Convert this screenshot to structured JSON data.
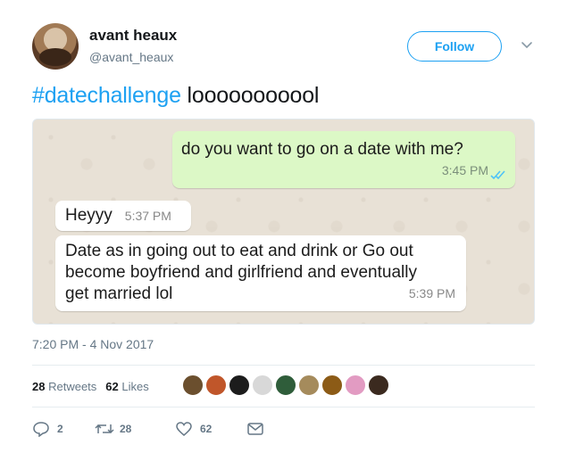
{
  "user": {
    "name": "avant heaux",
    "handle": "@avant_heaux",
    "follow_label": "Follow"
  },
  "tweet": {
    "hashtag": "#datechallenge",
    "text": " looooooooool",
    "timestamp": "7:20 PM - 4 Nov 2017"
  },
  "chat": {
    "outgoing": {
      "text": "do you want to go on a date with me?",
      "time": "3:45 PM"
    },
    "incoming1": {
      "text": "Heyyy",
      "time": "5:37 PM"
    },
    "incoming2": {
      "text": "Date as in going out to eat and drink or    Go out become boyfriend and girlfriend and eventually get married lol",
      "time": "5:39 PM"
    }
  },
  "stats": {
    "retweets_count": "28",
    "retweets_label": "Retweets",
    "likes_count": "62",
    "likes_label": "Likes"
  },
  "likers": [
    {
      "icon": "liker-avatar",
      "color": "#6b4f2e"
    },
    {
      "icon": "liker-avatar",
      "color": "#c0562a"
    },
    {
      "icon": "liker-avatar",
      "color": "#1c1c1c"
    },
    {
      "icon": "liker-avatar",
      "color": "#d8d8d8"
    },
    {
      "icon": "liker-avatar",
      "color": "#2f5d3a"
    },
    {
      "icon": "liker-avatar",
      "color": "#a58b5c"
    },
    {
      "icon": "liker-avatar",
      "color": "#8c5b16"
    },
    {
      "icon": "liker-avatar",
      "color": "#e29bc2"
    },
    {
      "icon": "liker-avatar",
      "color": "#3b2a1f"
    }
  ],
  "actions": {
    "replies": "2",
    "retweets": "28",
    "likes": "62"
  },
  "colors": {
    "accent": "#1da1f2",
    "muted": "#657786",
    "outgoing_bubble": "#dcf8c6",
    "chat_background": "#e8e1d6"
  }
}
